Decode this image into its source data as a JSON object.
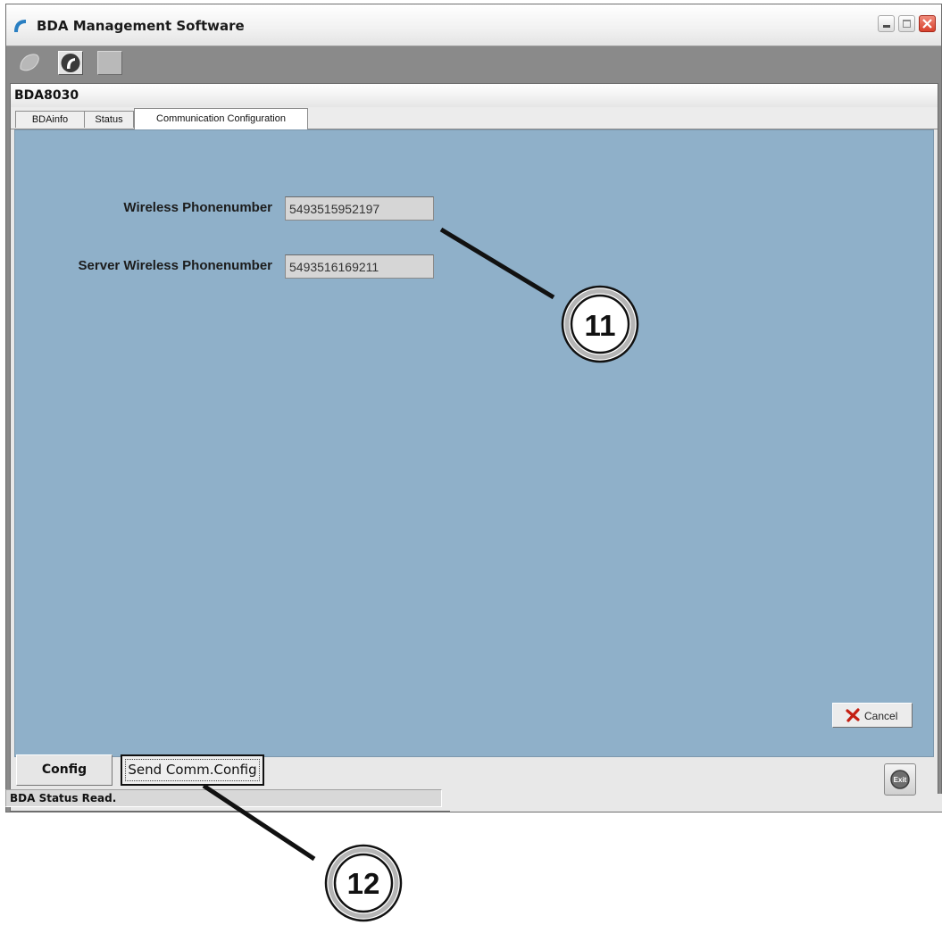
{
  "window": {
    "title": "BDA Management Software"
  },
  "toolbar": {
    "items": [
      "map-icon",
      "logo-icon",
      "blank-icon"
    ]
  },
  "inner": {
    "title": "BDA8030"
  },
  "tabs": [
    {
      "label": "BDAinfo"
    },
    {
      "label": "Status"
    },
    {
      "label": "Communication Configuration",
      "active": true
    }
  ],
  "form": {
    "wireless_label": "Wireless Phonenumber",
    "wireless_value": "5493515952197",
    "server_label": "Server Wireless Phonenumber",
    "server_value": "5493516169211"
  },
  "buttons": {
    "cancel": "Cancel",
    "config": "Config",
    "send_comm": "Send Comm.Config",
    "exit": "Exit"
  },
  "status": {
    "text": "BDA Status Read."
  },
  "callouts": {
    "a": "11",
    "b": "12"
  },
  "colors": {
    "panel": "#8fb0c9",
    "close": "#d8412d"
  }
}
